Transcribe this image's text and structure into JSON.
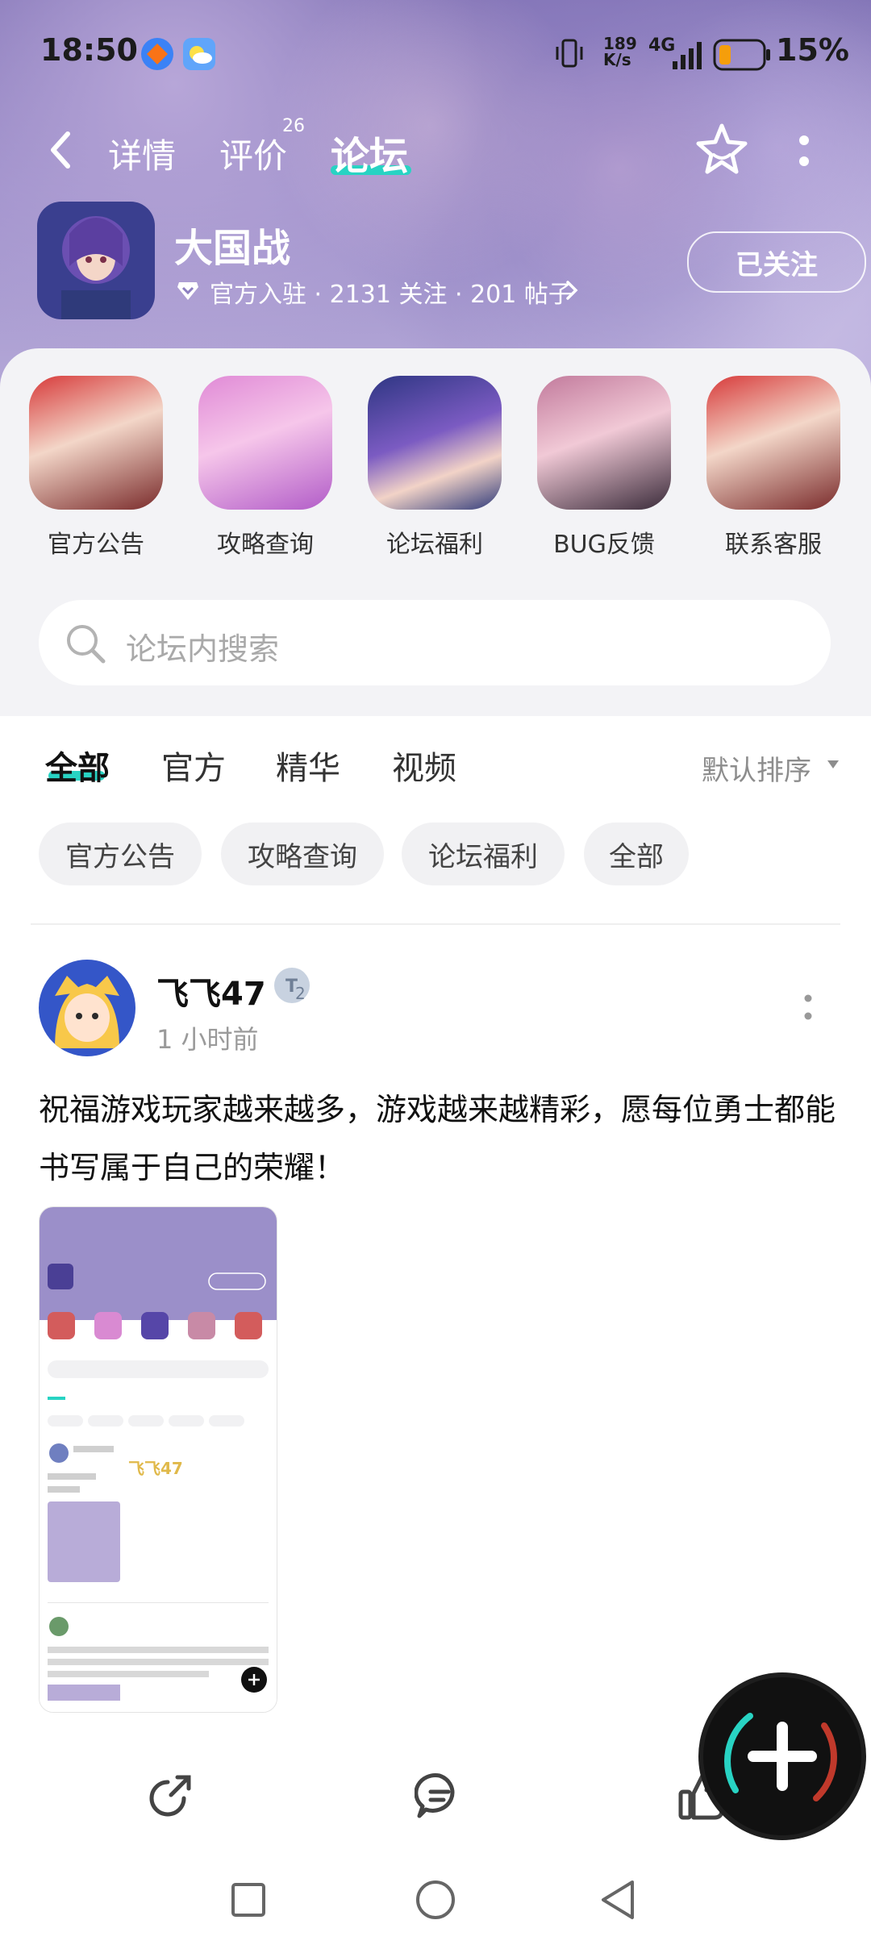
{
  "status_bar": {
    "time": "18:50",
    "network_speed": "189\nK/s",
    "network_type": "4G",
    "battery": "15%"
  },
  "nav": {
    "tabs": [
      {
        "label": "详情"
      },
      {
        "label": "评价",
        "badge": "26"
      },
      {
        "label": "论坛"
      }
    ],
    "active_tab": "论坛"
  },
  "game": {
    "name": "大国战",
    "meta": "官方入驻 · 2131 关注 · 201 帖子",
    "follow_label": "已关注"
  },
  "shortcuts": [
    {
      "label": "官方公告"
    },
    {
      "label": "攻略查询"
    },
    {
      "label": "论坛福利"
    },
    {
      "label": "BUG反馈"
    },
    {
      "label": "联系客服"
    }
  ],
  "search": {
    "placeholder": "论坛内搜索"
  },
  "feed_tabs": [
    {
      "label": "全部"
    },
    {
      "label": "官方"
    },
    {
      "label": "精华"
    },
    {
      "label": "视频"
    }
  ],
  "sort_label": "默认排序",
  "chips": [
    {
      "label": "官方公告"
    },
    {
      "label": "攻略查询"
    },
    {
      "label": "论坛福利"
    },
    {
      "label": "全部"
    }
  ],
  "post": {
    "author": "飞飞47",
    "level_badge": "2",
    "time": "1 小时前",
    "text": "祝福游戏玩家越来越多，游戏越来越精彩，愿每位勇士都能书写属于自己的荣耀！",
    "image_watermark": "飞飞47"
  },
  "colors": {
    "accent": "#28d3c3",
    "banner": "#8c7ec0"
  }
}
